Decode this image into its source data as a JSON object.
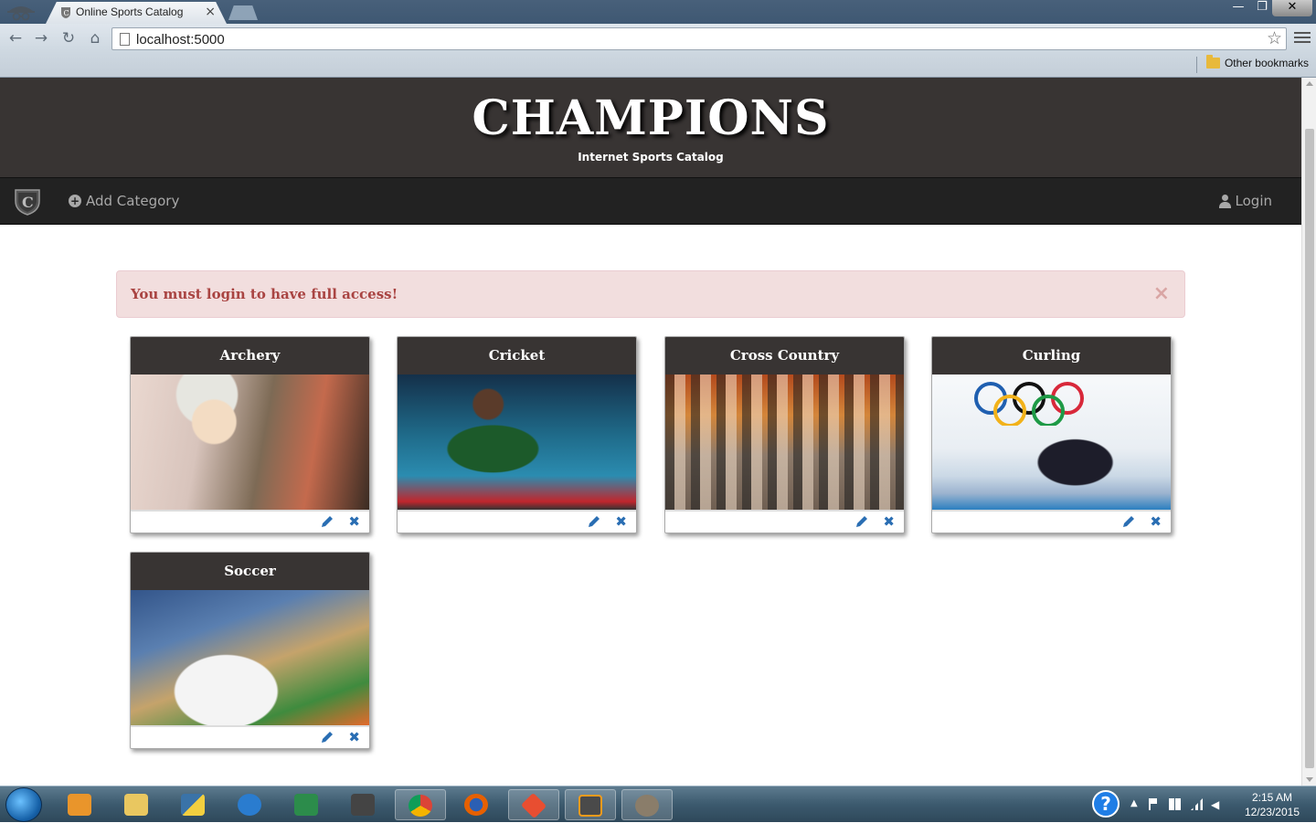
{
  "browser": {
    "tab_title": "Online Sports Catalog",
    "tab_close": "×",
    "url": "localhost:5000",
    "bookmark_other": "Other bookmarks",
    "win_min": "—",
    "win_max": "❐",
    "win_close": "✕"
  },
  "site": {
    "title": "CHAMPIONS",
    "subtitle": "Internet Sports Catalog"
  },
  "nav": {
    "add_category": "Add Category",
    "login": "Login"
  },
  "alert": {
    "message": "You must login to have full access!",
    "close": "×"
  },
  "categories": [
    {
      "name": "Archery"
    },
    {
      "name": "Cricket"
    },
    {
      "name": "Cross Country"
    },
    {
      "name": "Curling"
    },
    {
      "name": "Soccer"
    }
  ],
  "taskbar": {
    "time": "2:15 AM",
    "date": "12/23/2015",
    "help": "?"
  },
  "colors": {
    "header_bg": "#383433",
    "nav_bg": "#222222",
    "alert_bg": "#f2dede",
    "alert_text": "#a94442",
    "action_blue": "#2a6eb3"
  }
}
